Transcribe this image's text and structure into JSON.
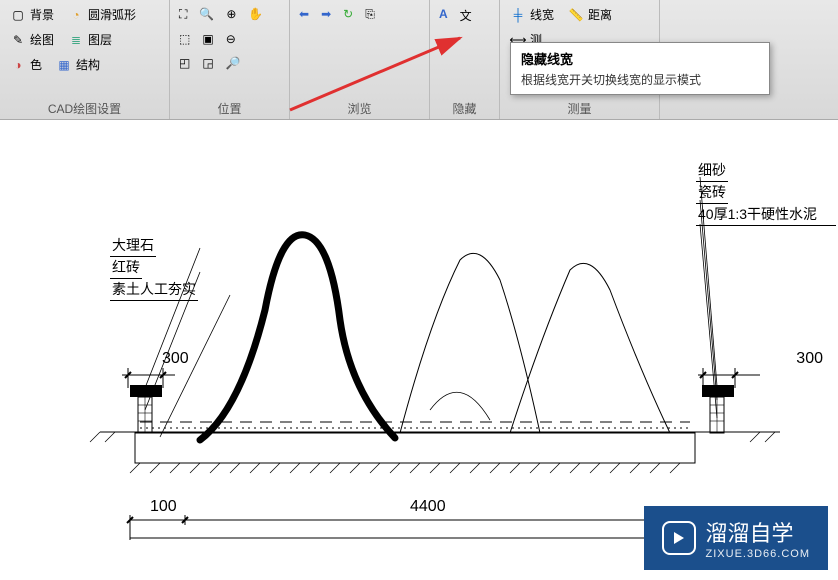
{
  "ribbon": {
    "group_cad": {
      "label": "CAD绘图设置",
      "items": {
        "bg": "背景",
        "draw": "绘图",
        "color": "色",
        "arc": "圆滑弧形",
        "layer": "图层",
        "structure": "结构"
      }
    },
    "group_position": {
      "label": "位置"
    },
    "group_browse": {
      "label": "浏览"
    },
    "group_hide": {
      "label": "隐藏"
    },
    "group_measure": {
      "label": "测量",
      "lineweight": "线宽",
      "distance": "距离",
      "measure_partial": "测"
    }
  },
  "tooltip": {
    "title": "隐藏线宽",
    "body": "根据线宽开关切换线宽的显示模式"
  },
  "drawing": {
    "materials_left": [
      "大理石",
      "红砖",
      "素土人工夯实"
    ],
    "materials_right": [
      "细砂",
      "瓷砖",
      "40厚1:3干硬性水泥"
    ],
    "dims": {
      "left_top": "300",
      "right_top": "300",
      "bottom_left": "100",
      "bottom_mid": "4400"
    }
  },
  "watermark": {
    "title": "溜溜自学",
    "sub": "ZIXUE.3D66.COM"
  }
}
